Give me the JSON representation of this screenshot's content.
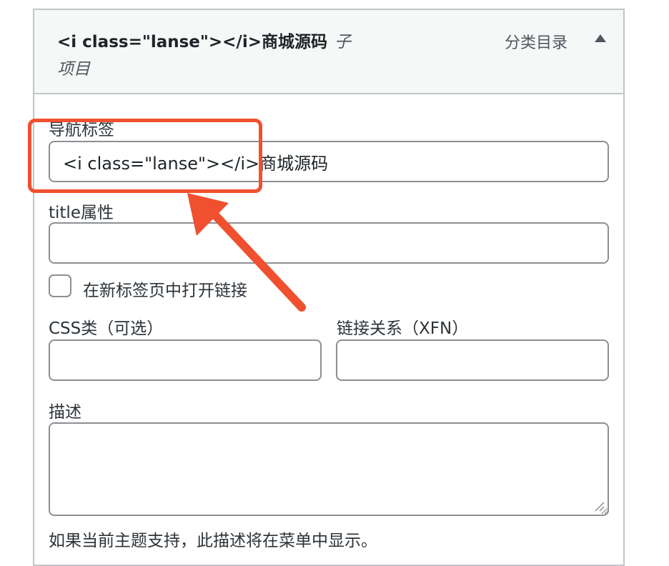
{
  "menu_item": {
    "title": "<i class=\"lanse\"></i>商城源码",
    "sub_tag": "子项目",
    "type_label": "分类目录"
  },
  "fields": {
    "nav_label": {
      "label": "导航标签",
      "value": "<i class=\"lanse\"></i>商城源码"
    },
    "title_attr": {
      "label": "title属性",
      "value": ""
    },
    "new_tab": {
      "label": "在新标签页中打开链接",
      "checked": false
    },
    "css_classes": {
      "label": "CSS类（可选）",
      "value": ""
    },
    "xfn": {
      "label": "链接关系（XFN）",
      "value": ""
    },
    "description": {
      "label": "描述",
      "value": "",
      "help": "如果当前主题支持，此描述将在菜单中显示。"
    }
  },
  "annotation": {
    "color": "#f0502f"
  },
  "colors": {
    "border": "#c3c4c7",
    "input_border": "#8c8f94",
    "header_bg": "#f6f7f7"
  }
}
